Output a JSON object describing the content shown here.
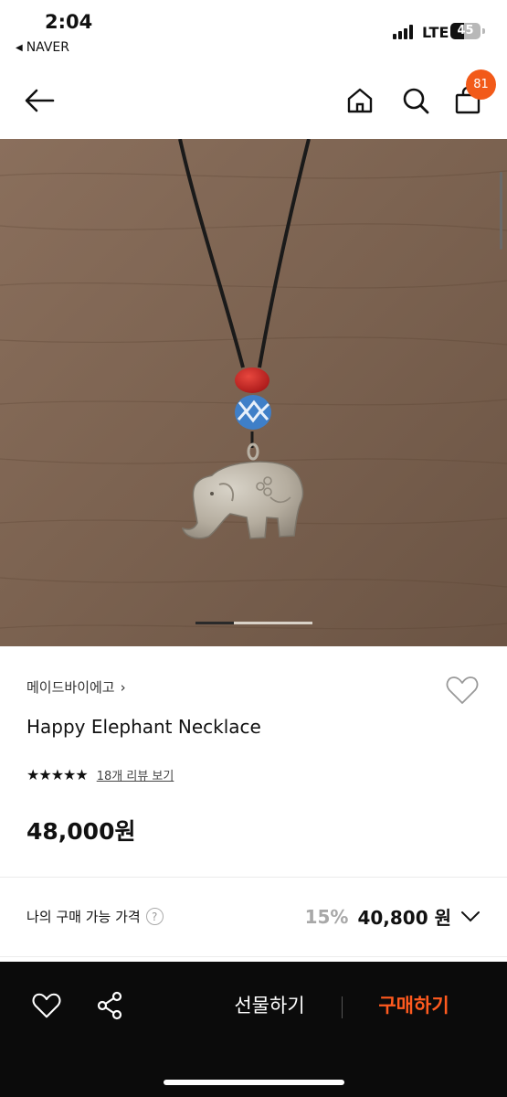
{
  "status_bar": {
    "time": "2:04",
    "back_app": "NAVER",
    "network": "LTE",
    "battery": "45",
    "battery_level": 0.45
  },
  "header": {
    "cart_count": "81",
    "accent": "#f25a19"
  },
  "gallery": {
    "current_index": 1,
    "total_indicator_fraction": 0.33
  },
  "product": {
    "brand": "메이드바이에고",
    "brand_chevron": "›",
    "name": "Happy Elephant Necklace",
    "stars": "★★★★★",
    "rating": 5,
    "reviews_link": "18개 리뷰 보기",
    "price": "48,000원"
  },
  "my_price": {
    "label": "나의 구매 가능 가격",
    "help": "?",
    "discount": "15%",
    "discounted_price": "40,800 원"
  },
  "bottom_bar": {
    "gift_label": "선물하기",
    "buy_label": "구매하기",
    "buy_color": "#ff5a1f"
  },
  "icons": [
    "back-arrow-icon",
    "home-icon",
    "search-icon",
    "cart-icon",
    "heart-icon",
    "share-icon",
    "chevron-down-icon",
    "help-icon"
  ]
}
